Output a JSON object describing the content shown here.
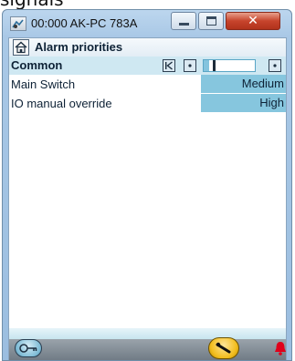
{
  "caption": "signals",
  "window": {
    "title": "00:000 AK-PC 783A",
    "close_glyph": "✕"
  },
  "header": {
    "title": "Alarm priorities"
  },
  "group": {
    "title": "Common"
  },
  "rows": [
    {
      "label": "Main Switch",
      "value": "Medium"
    },
    {
      "label": "IO manual override",
      "value": "High"
    }
  ],
  "colors": {
    "value_cell": "#86c6de",
    "group_bg": "#cfe8f2",
    "alarm_red": "#e0001b",
    "service_yellow": "#f2bd1d"
  }
}
